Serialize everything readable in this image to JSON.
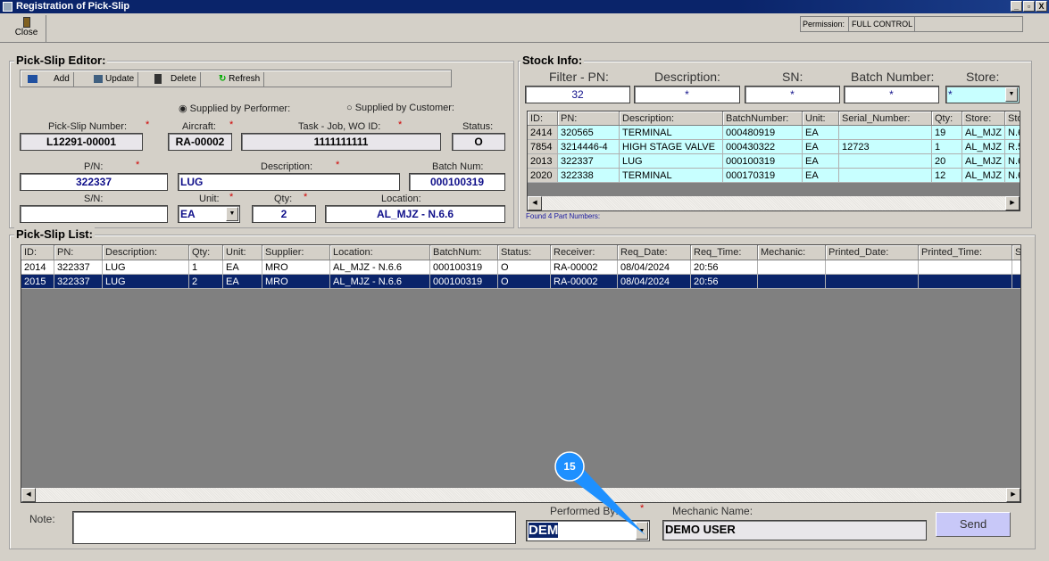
{
  "window": {
    "title": "Registration of Pick-Slip",
    "minimize": "_",
    "restore": "▫",
    "close": "X"
  },
  "toolbar": {
    "close_label": "Close",
    "permission_label": "Permission:",
    "permission_value": "FULL CONTROL"
  },
  "editor": {
    "title": "Pick-Slip Editor:",
    "buttons": {
      "add": "Add",
      "update": "Update",
      "delete": "Delete",
      "refresh": "Refresh"
    },
    "radio_performer": "Supplied by Performer:",
    "radio_customer": "Supplied by Customer:",
    "labels": {
      "pick_slip_number": "Pick-Slip Number:",
      "aircraft": "Aircraft:",
      "task": "Task - Job, WO ID:",
      "status": "Status:",
      "pn": "P/N:",
      "description": "Description:",
      "batch": "Batch Num:",
      "sn": "S/N:",
      "unit": "Unit:",
      "qty": "Qty:",
      "location": "Location:"
    },
    "values": {
      "pick_slip_number": "L12291-00001",
      "aircraft": "RA-00002",
      "task": "1111111111",
      "status": "O",
      "pn": "322337",
      "description": "LUG",
      "batch": "000100319",
      "sn": "",
      "unit": "EA",
      "qty": "2",
      "location": "AL_MJZ - N.6.6"
    },
    "required_mark": "*"
  },
  "stock": {
    "title": "Stock Info:",
    "filter_labels": {
      "pn": "Filter - PN:",
      "description": "Description:",
      "sn": "SN:",
      "batch": "Batch Number:",
      "store": "Store:"
    },
    "filter_values": {
      "pn": "32",
      "description": "*",
      "sn": "*",
      "batch": "*",
      "store": "*"
    },
    "columns": [
      "ID:",
      "PN:",
      "Description:",
      "BatchNumber:",
      "Unit:",
      "Serial_Number:",
      "Qty:",
      "Store:",
      "Sto"
    ],
    "rows": [
      [
        "2414",
        "320565",
        "TERMINAL",
        "000480919",
        "EA",
        "",
        "19",
        "AL_MJZ",
        "N.6"
      ],
      [
        "7854",
        "3214446-4",
        "HIGH STAGE VALVE",
        "000430322",
        "EA",
        "12723",
        "1",
        "AL_MJZ",
        "R.5"
      ],
      [
        "2013",
        "322337",
        "LUG",
        "000100319",
        "EA",
        "",
        "20",
        "AL_MJZ",
        "N.6"
      ],
      [
        "2020",
        "322338",
        "TERMINAL",
        "000170319",
        "EA",
        "",
        "12",
        "AL_MJZ",
        "N.6"
      ]
    ],
    "found_text": "Found 4 Part Numbers:"
  },
  "list": {
    "title": "Pick-Slip List:",
    "columns": [
      "ID:",
      "PN:",
      "Description:",
      "Qty:",
      "Unit:",
      "Supplier:",
      "Location:",
      "BatchNum:",
      "Status:",
      "Receiver:",
      "Req_Date:",
      "Req_Time:",
      "Mechanic:",
      "Printed_Date:",
      "Printed_Time:",
      "S"
    ],
    "rows": [
      [
        "2014",
        "322337",
        "LUG",
        "1",
        "EA",
        "MRO",
        "AL_MJZ - N.6.6",
        "000100319",
        "O",
        "RA-00002",
        "08/04/2024",
        "20:56",
        "",
        "",
        "",
        ""
      ],
      [
        "2015",
        "322337",
        "LUG",
        "2",
        "EA",
        "MRO",
        "AL_MJZ - N.6.6",
        "000100319",
        "O",
        "RA-00002",
        "08/04/2024",
        "20:56",
        "",
        "",
        "",
        ""
      ]
    ],
    "selected_row": 1
  },
  "footer": {
    "note_label": "Note:",
    "note_value": "",
    "performed_by_label": "Performed By:",
    "performed_by_value": "DEM",
    "mechanic_name_label": "Mechanic  Name:",
    "mechanic_name_value": "DEMO USER",
    "send_label": "Send"
  },
  "callout": {
    "number": "15",
    "color": "#1e90ff"
  }
}
